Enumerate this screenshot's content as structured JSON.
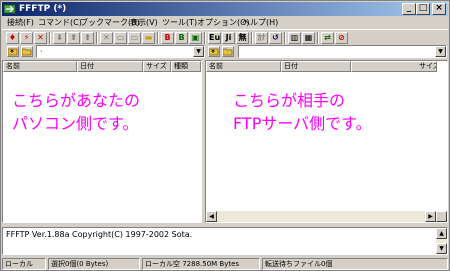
{
  "window": {
    "title": "FFFTP (*)",
    "min": "_",
    "max": "□",
    "close": "×"
  },
  "menu": [
    "接続(F)",
    "コマンド(C)",
    "ブックマーク(B)",
    "表示(V)",
    "ツール(T)",
    "オプション(O)",
    "ヘルプ(H)"
  ],
  "toolbar": {
    "buttons": [
      "connect",
      "quick-connect",
      "disconnect",
      "download",
      "upload",
      "download-name",
      "delete",
      "rename",
      "mkdir",
      "refresh-b",
      "refresh-l",
      "refresh-r",
      "euc",
      "jis",
      "none",
      "kana",
      "rotate",
      "list",
      "detail",
      "sync",
      "stop"
    ],
    "labels": {
      "euc": "Eu",
      "jis": "Ji",
      "none": "無",
      "kana": "ｶﾅ"
    }
  },
  "local": {
    "path": "·",
    "columns": [
      "名前",
      "日付",
      "サイズ",
      "種類"
    ],
    "note_line1": "こちらがあなたの",
    "note_line2": "パソコン側です。"
  },
  "remote": {
    "path": "",
    "columns": [
      "名前",
      "日付",
      "サイズ"
    ],
    "note_line1": "こちらが相手の",
    "note_line2": "FTPサーバ側です。"
  },
  "log": {
    "text": "FFFTP Ver.1.88a Copyright(C) 1997-2002 Sota."
  },
  "status": {
    "local": "ローカル",
    "selected": "選択0個(0 Bytes)",
    "free": "ローカル空 7288.50M Bytes",
    "queue": "転送待ちファイル0個"
  },
  "colors": {
    "note": "#ff00ff",
    "title_from": "#0a246a",
    "title_to": "#a6caf0"
  }
}
